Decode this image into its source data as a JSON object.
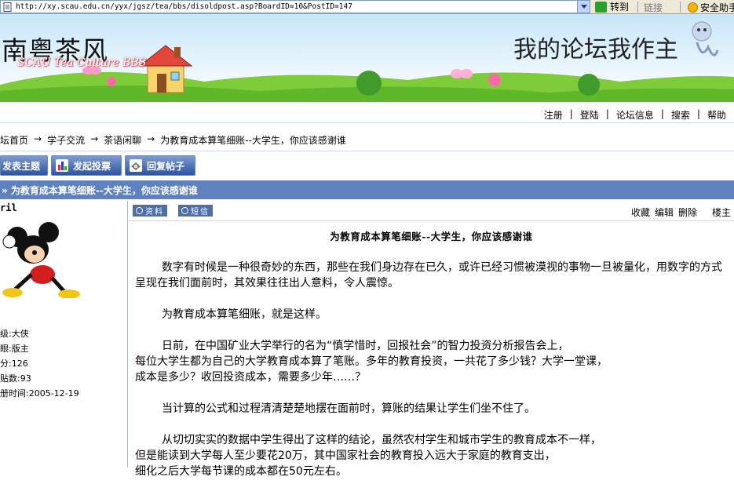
{
  "address": {
    "url": "http://xy.scau.edu.cn/yyx/jgsz/tea/bbs/disoldpost.asp?BoardID=10&PostID=147",
    "go_label": "转到",
    "links_label": "链接",
    "helper_label": "安全助手"
  },
  "banner": {
    "logo": "南粤茶风",
    "subtitle": "SCAU Tea Culture BBS",
    "slogan": "我的论坛我作主"
  },
  "topnav": {
    "items": [
      "注册",
      "登陆",
      "论坛信息",
      "搜索",
      "帮助"
    ]
  },
  "breadcrumb": {
    "items": [
      "坛首页",
      "学子交流",
      "茶语闲聊",
      "为教育成本算笔细账--大学生，你应该感谢谁"
    ],
    "separator": "→"
  },
  "actions": {
    "new_topic": "发表主题",
    "new_vote": "发起投票",
    "reply": "回复帖子"
  },
  "topic": {
    "title": "» 为教育成本算笔细账--大学生，你应该感谢谁"
  },
  "author": {
    "name": "ril",
    "level": "级:大侠",
    "role": "眼:版主",
    "points": "分:126",
    "posts": "贴数:93",
    "registered": "册时间:2005-12-19"
  },
  "post_tools": {
    "profile": "资料",
    "message": "短信",
    "favorite": "收藏",
    "edit": "编辑",
    "delete": "删除",
    "floor": "楼主"
  },
  "post": {
    "title": "为教育成本算笔细账--大学生，你应该感谢谁",
    "paragraphs": [
      "数字有时候是一种很奇妙的东西，那些在我们身边存在已久，或许已经习惯被漠视的事物一旦被量化，用数字的方式呈现在我们面前时，其效果往往出人意料，令人震惊。",
      "为教育成本算笔细账，就是这样。",
      "日前，在中国矿业大学举行的名为“慎学惜时，回报社会”的智力投资分析报告会上，",
      "每位大学生都为自己的大学教育成本算了笔账。多年的教育投资，一共花了多少钱？大学一堂课，",
      "成本是多少？收回投资成本，需要多少年……？",
      "当计算的公式和过程清清楚楚地摆在面前时，算账的结果让学生们坐不住了。",
      "从切切实实的数据中学生得出了这样的结论，虽然农村学生和城市学生的教育成本不一样，",
      "但是能读到大学每人至少要花20万，其中国家社会的教育投入远大于家庭的教育支出，",
      "细化之后大学每节课的成本都在50元左右。"
    ]
  }
}
